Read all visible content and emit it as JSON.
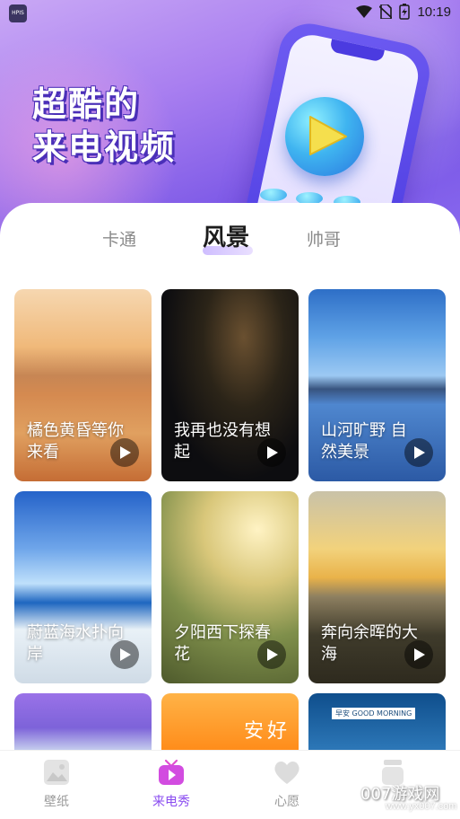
{
  "status_bar": {
    "app_icon_text": "HPIS",
    "time": "10:19",
    "icons": [
      "wifi-icon",
      "no-sim-icon",
      "battery-charging-icon"
    ]
  },
  "hero": {
    "title_line1": "超酷的",
    "title_line2": "来电视频"
  },
  "tabs": [
    {
      "label": "卡通",
      "active": false
    },
    {
      "label": "风景",
      "active": true
    },
    {
      "label": "帅哥",
      "active": false
    }
  ],
  "videos": [
    {
      "title": "橘色黄昏等你来看"
    },
    {
      "title": "我再也没有想起"
    },
    {
      "title": "山河旷野 自然美景"
    },
    {
      "title": "蔚蓝海水扑向岸"
    },
    {
      "title": "夕阳西下探春花"
    },
    {
      "title": "奔向余晖的大海"
    }
  ],
  "partial_cards": {
    "orange_text": "安好",
    "sea_banner": "早安 GOOD MORNING"
  },
  "bottom_nav": [
    {
      "label": "壁纸",
      "icon": "image-icon",
      "active": false
    },
    {
      "label": "来电秀",
      "icon": "tv-play-icon",
      "active": true
    },
    {
      "label": "心愿",
      "icon": "heart-icon",
      "active": false
    },
    {
      "label": "",
      "icon": "profile-icon",
      "active": false
    }
  ],
  "watermark": {
    "text": "007游戏网",
    "url": "www.yx007.com"
  },
  "colors": {
    "accent": "#8a4cf0",
    "hero_purple": "#7a57e6"
  }
}
